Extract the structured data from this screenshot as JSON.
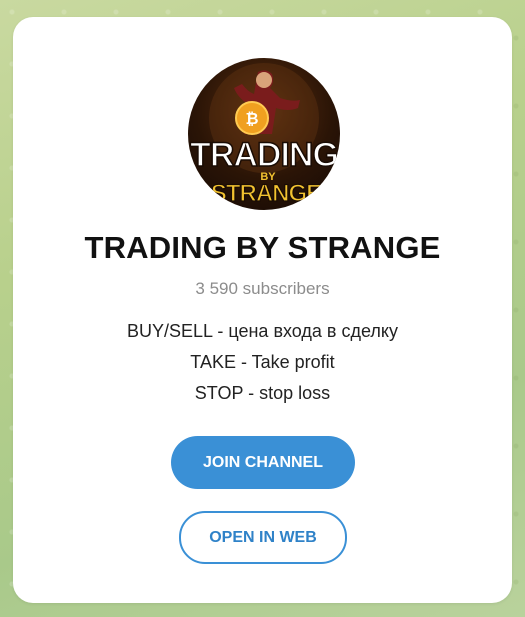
{
  "channel": {
    "title": "TRADING BY STRANGE",
    "subscribers": "3 590 subscribers",
    "description": [
      "BUY/SELL - цена входа в сделку",
      "TAKE - Take profit",
      "STOP - stop loss"
    ],
    "avatar": {
      "icon": "channel-avatar-icon",
      "line1": "TRADING",
      "line2": "BY",
      "line3": "STRANGE",
      "coin_symbol": "₿",
      "colors": {
        "text": "#ffffff",
        "text_accent": "#f2c230",
        "coin": "#f0a020",
        "background": "#2a1406"
      }
    }
  },
  "buttons": {
    "join": "JOIN CHANNEL",
    "open_web": "OPEN IN WEB"
  },
  "colors": {
    "accent": "#3a90d6",
    "card_background": "#ffffff",
    "subtitle": "#8c8c8c"
  }
}
